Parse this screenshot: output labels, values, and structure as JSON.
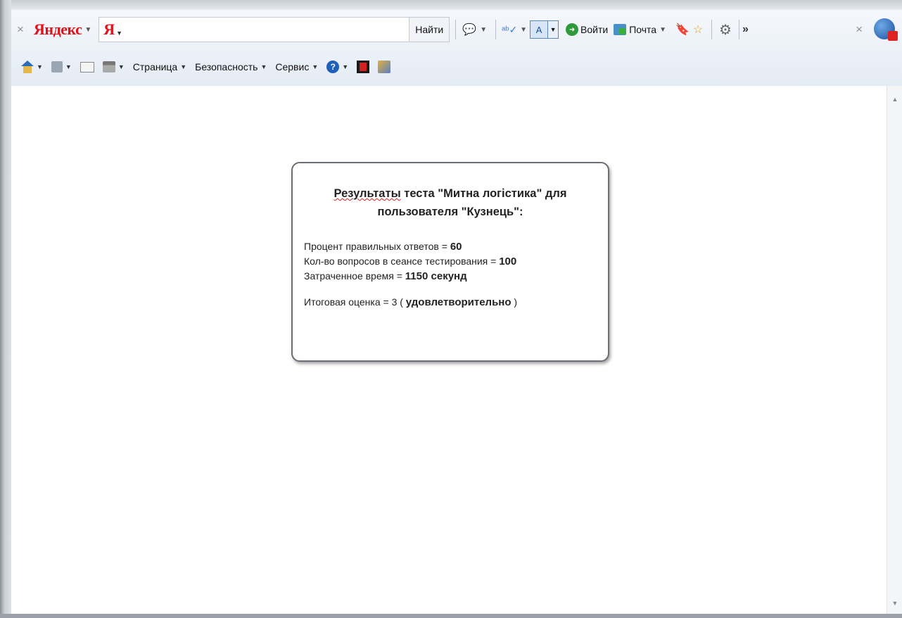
{
  "yandex_bar": {
    "logo": "Яндекс",
    "search_prefix": "Я",
    "search_value": "",
    "search_button": "Найти",
    "login_label": "Войти",
    "mail_label": "Почта",
    "more_label": "»"
  },
  "command_bar": {
    "page_label": "Страница",
    "security_label": "Безопасность",
    "service_label": "Сервис"
  },
  "result": {
    "title_first_word": "Результаты",
    "title_rest": " теста \"Митна логістика\" для",
    "title_line2": "пользователя \"Кузнець\":",
    "correct_label": "Процент правильных ответов = ",
    "correct_value": "60",
    "questions_label": "Кол-во вопросов в сеансе тестирования = ",
    "questions_value": "100",
    "time_label": "Затраченное время = ",
    "time_value": "1150 секунд",
    "grade_label": "Итоговая оценка = 3 ( ",
    "grade_value": "удовлетворительно",
    "grade_close": " )"
  },
  "colors": {
    "yandex_red": "#e0121b",
    "accent_blue": "#1e5fb8"
  }
}
